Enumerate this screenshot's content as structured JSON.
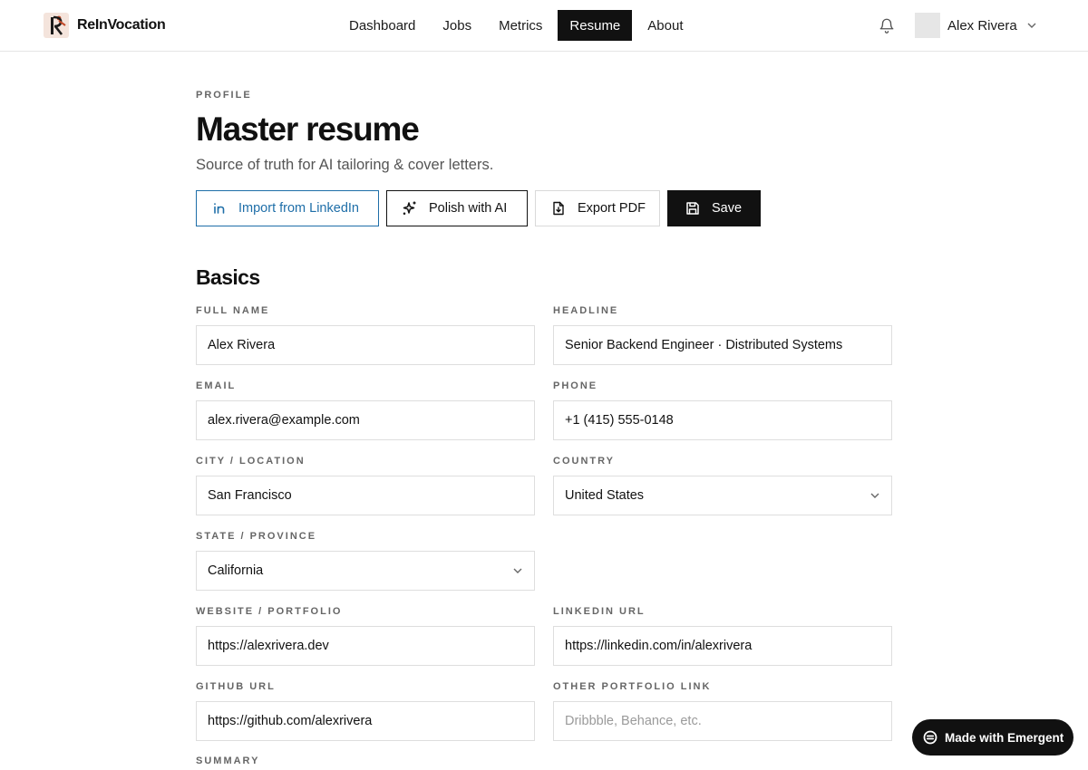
{
  "brand": {
    "name": "ReInVocation"
  },
  "nav": {
    "items": [
      {
        "label": "Dashboard",
        "active": false
      },
      {
        "label": "Jobs",
        "active": false
      },
      {
        "label": "Metrics",
        "active": false
      },
      {
        "label": "Resume",
        "active": true
      },
      {
        "label": "About",
        "active": false
      }
    ]
  },
  "user": {
    "name": "Alex Rivera"
  },
  "page": {
    "eyebrow": "PROFILE",
    "title": "Master resume",
    "subtitle": "Source of truth for AI tailoring & cover letters."
  },
  "actions": {
    "linkedin": "Import from LinkedIn",
    "polish": "Polish with AI",
    "export": "Export PDF",
    "save": "Save"
  },
  "basics": {
    "title": "Basics",
    "full_name": {
      "label": "FULL NAME",
      "value": "Alex Rivera"
    },
    "headline": {
      "label": "HEADLINE",
      "value": "Senior Backend Engineer · Distributed Systems"
    },
    "email": {
      "label": "EMAIL",
      "value": "alex.rivera@example.com"
    },
    "phone": {
      "label": "PHONE",
      "value": "+1 (415) 555-0148"
    },
    "city": {
      "label": "CITY / LOCATION",
      "value": "San Francisco"
    },
    "country": {
      "label": "COUNTRY",
      "value": "United States"
    },
    "state": {
      "label": "STATE / PROVINCE",
      "value": "California"
    },
    "website": {
      "label": "WEBSITE / PORTFOLIO",
      "value": "https://alexrivera.dev"
    },
    "linkedin_url": {
      "label": "LINKEDIN URL",
      "value": "https://linkedin.com/in/alexrivera"
    },
    "github_url": {
      "label": "GITHUB URL",
      "value": "https://github.com/alexrivera"
    },
    "other_link": {
      "label": "OTHER PORTFOLIO LINK",
      "placeholder": "Dribbble, Behance, etc."
    },
    "summary_label": "SUMMARY"
  },
  "badge": {
    "label": "Made with Emergent"
  },
  "colors": {
    "accent": "#111111",
    "linkedin": "#1e6ea8",
    "border": "#dedede",
    "logo": "#c24a2a"
  }
}
